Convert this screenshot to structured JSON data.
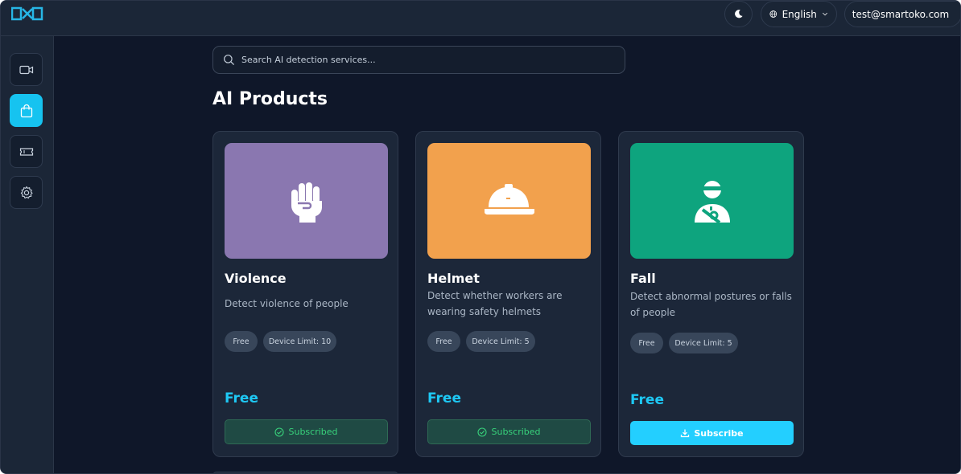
{
  "header": {
    "language": "English",
    "user_email": "test@smartoko.com",
    "icons": [
      "logo-icon",
      "moon-icon",
      "globe-icon",
      "chevron-down-icon"
    ]
  },
  "sidebar": {
    "items": [
      {
        "name": "video-camera",
        "icon": "video-camera-icon",
        "active": false
      },
      {
        "name": "products",
        "icon": "shopping-bag-icon",
        "active": true
      },
      {
        "name": "tickets",
        "icon": "ticket-icon",
        "active": false
      },
      {
        "name": "settings",
        "icon": "gear-icon",
        "active": false
      }
    ]
  },
  "search": {
    "placeholder": "Search AI detection services..."
  },
  "main": {
    "title": "AI Products",
    "products": [
      {
        "name": "Violence",
        "description": "Detect violence of people",
        "tags": [
          "Free",
          "Device Limit: 10"
        ],
        "price": "Free",
        "button": "Subscribed",
        "button_state": "subscribed",
        "image_color": "#8a77b0",
        "icon": "fist-icon"
      },
      {
        "name": "Helmet",
        "description": "Detect whether workers are wearing safety helmets",
        "tags": [
          "Free",
          "Device Limit: 5"
        ],
        "price": "Free",
        "button": "Subscribed",
        "button_state": "subscribed",
        "image_color": "#f2a14d",
        "icon": "hard-hat-icon"
      },
      {
        "name": "Fall",
        "description": "Detect abnormal postures or falls of people",
        "tags": [
          "Free",
          "Device Limit: 5"
        ],
        "price": "Free",
        "button": "Subscribe",
        "button_state": "subscribe",
        "image_color": "#0ea47e",
        "icon": "injured-person-icon"
      }
    ]
  },
  "colors": {
    "accent": "#16c3f0",
    "background": "#0f1729",
    "panel": "#1b2637",
    "subscribed_text": "#38d27b"
  }
}
